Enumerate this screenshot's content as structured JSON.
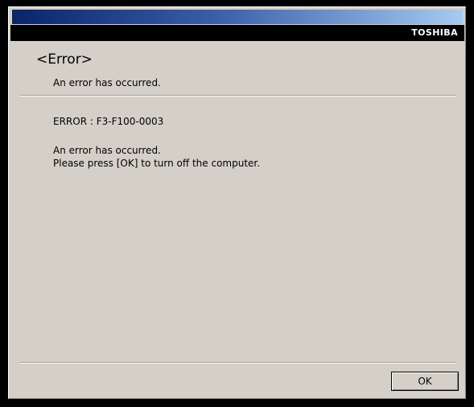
{
  "window": {
    "brand": "TOSHIBA",
    "heading": "<Error>",
    "subheading": "An error has occurred."
  },
  "error": {
    "code_line": "ERROR : F3-F100-0003",
    "message_line1": "An error has occurred.",
    "message_line2": "Please press [OK] to turn off the computer."
  },
  "buttons": {
    "ok_label": "OK"
  }
}
